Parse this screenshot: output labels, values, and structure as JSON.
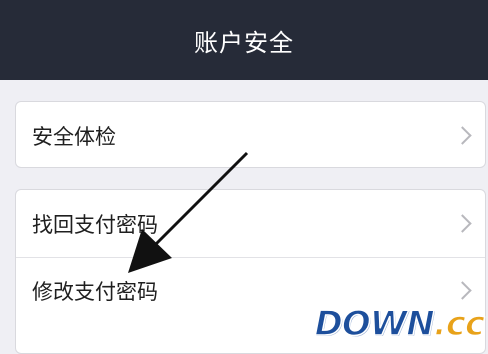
{
  "header": {
    "title": "账户安全"
  },
  "card1": {
    "items": [
      {
        "label": "安全体检"
      }
    ]
  },
  "card2": {
    "items": [
      {
        "label": "找回支付密码"
      },
      {
        "label": "修改支付密码"
      }
    ]
  },
  "watermark": {
    "main": "DOWN",
    "dot": ".",
    "suffix": "cc"
  },
  "colors": {
    "header_bg": "#262b38",
    "page_bg": "#efeff4",
    "watermark_blue": "#1d4f9c",
    "watermark_orange": "#e8a21a"
  }
}
